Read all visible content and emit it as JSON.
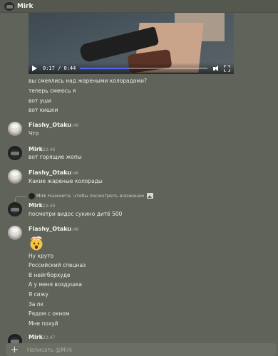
{
  "header": {
    "title": "Mirk"
  },
  "video": {
    "time": "0:17 / 0:44",
    "progress": 0.386,
    "accent": "#5865f2"
  },
  "messages_top": [
    "вы смеялись над жареными колорадами?",
    "теперь смеюсь я",
    "вот уши",
    "вот кишки"
  ],
  "groups": [
    {
      "user": "Flashy_Otaku",
      "time": "22:46",
      "text": "Что"
    },
    {
      "user": "Mirk",
      "time": "22:46",
      "text": "вот горящие жопы"
    },
    {
      "user": "Flashy_Otaku",
      "time": "22:46",
      "text": "Какие жареные колорады"
    },
    {
      "user": "Mirk",
      "time": "22:46",
      "text": "посмотри видос сукино дитё 500"
    }
  ],
  "reply": {
    "name": "Mirk",
    "text": "Нажмите, чтобы посмотреть вложение"
  },
  "last_group": {
    "user": "Flashy_Otaku",
    "time": "22:46",
    "emoji": "exploding-head-emoji",
    "lines": [
      "Ну круто",
      "Российский спецназ",
      "В нейгборхуде",
      "А у меня воздушка",
      "Я сижу",
      "За пк",
      "Рядом с окном",
      "Мне похуй"
    ]
  },
  "partial": {
    "user": "Mirk",
    "time": "22:47"
  },
  "composer": {
    "plus": "+",
    "placeholder": "Написать @Mirk"
  }
}
